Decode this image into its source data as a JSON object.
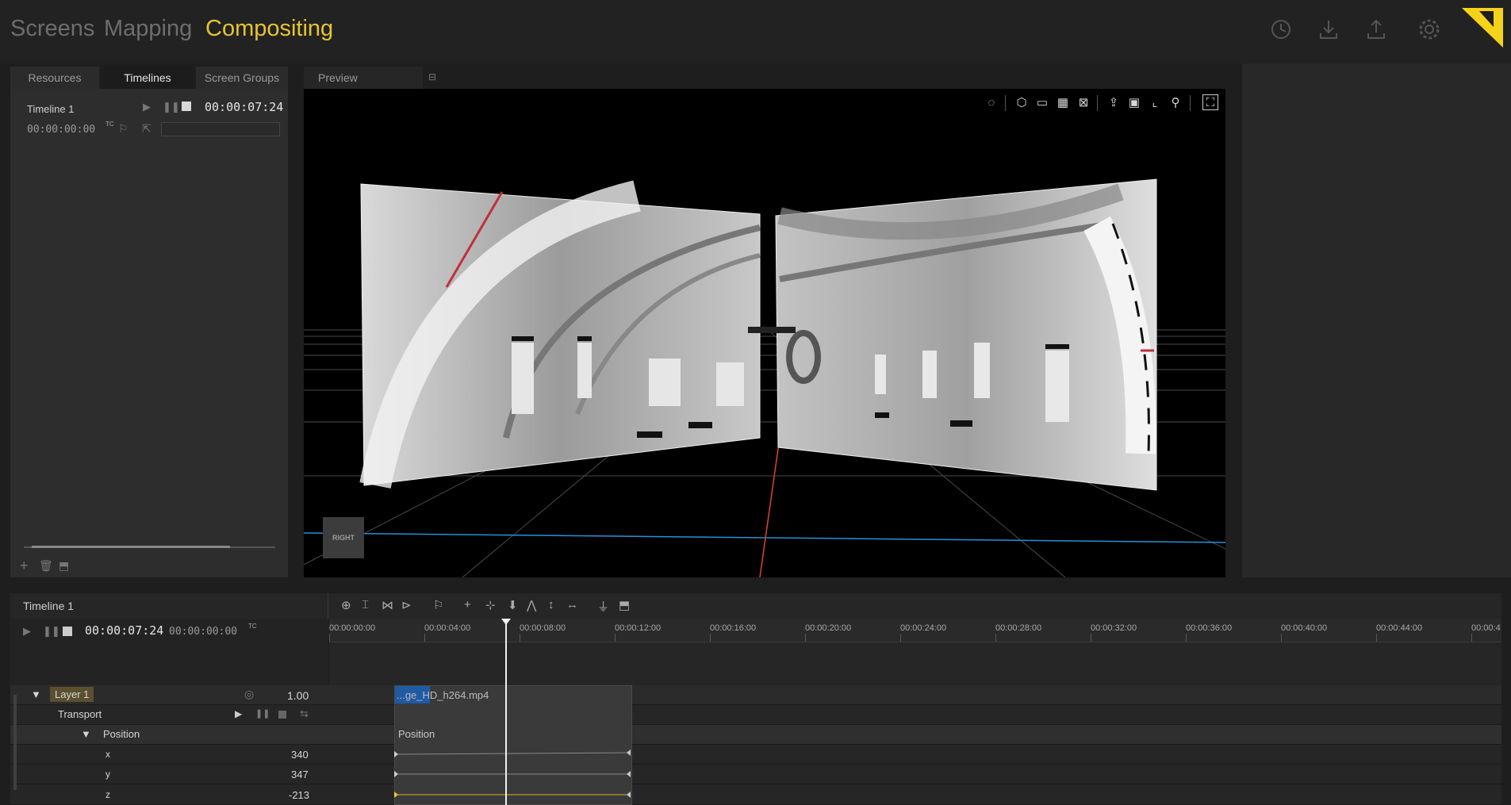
{
  "modes": [
    "Screens",
    "Mapping",
    "Compositing"
  ],
  "active_mode": "Compositing",
  "top_icons": [
    "clock-icon",
    "download-icon",
    "upload-icon",
    "gear-icon"
  ],
  "left_tabs": [
    "Resources",
    "Timelines",
    "Screen Groups"
  ],
  "timeline_item": {
    "name": "Timeline 1",
    "time": "00:00:07:24",
    "start": "00:00:00:00",
    "tc": "TC"
  },
  "preview": {
    "tab": "Preview",
    "badge": "RIGHT",
    "toolbar_icons": [
      "spinner-icon",
      "hexagon-icon",
      "folder-icon",
      "grid-icon",
      "mask-icon",
      "export-icon",
      "image-icon",
      "crop-icon",
      "zoom-icon",
      "select-screen-icon"
    ]
  },
  "timeline": {
    "title": "Timeline 1",
    "current_time": "00:00:07:24",
    "start_time": "00:00:00:00",
    "tc": "TC",
    "ruler": [
      "00:00:00:00",
      "00:00:04:00",
      "00:00:08:00",
      "00:00:12:00",
      "00:00:16:00",
      "00:00:20:00",
      "00:00:24:00",
      "00:00:28:00",
      "00:00:32:00",
      "00:00:36:00",
      "00:00:40:00",
      "00:00:44:00",
      "00:00:4"
    ],
    "playhead_fraction": 0.0
  },
  "layer": {
    "name": "Layer 1",
    "opacity": "1.00",
    "transport": "Transport",
    "position": "Position",
    "props": [
      {
        "name": "x",
        "value": "340"
      },
      {
        "name": "y",
        "value": "347"
      },
      {
        "name": "z",
        "value": "-213"
      }
    ]
  },
  "clip": {
    "name": "...ge_HD_h264.mp4",
    "track": "Position"
  },
  "colors": {
    "accent": "#e8c430",
    "logo": "#f6d31b"
  }
}
